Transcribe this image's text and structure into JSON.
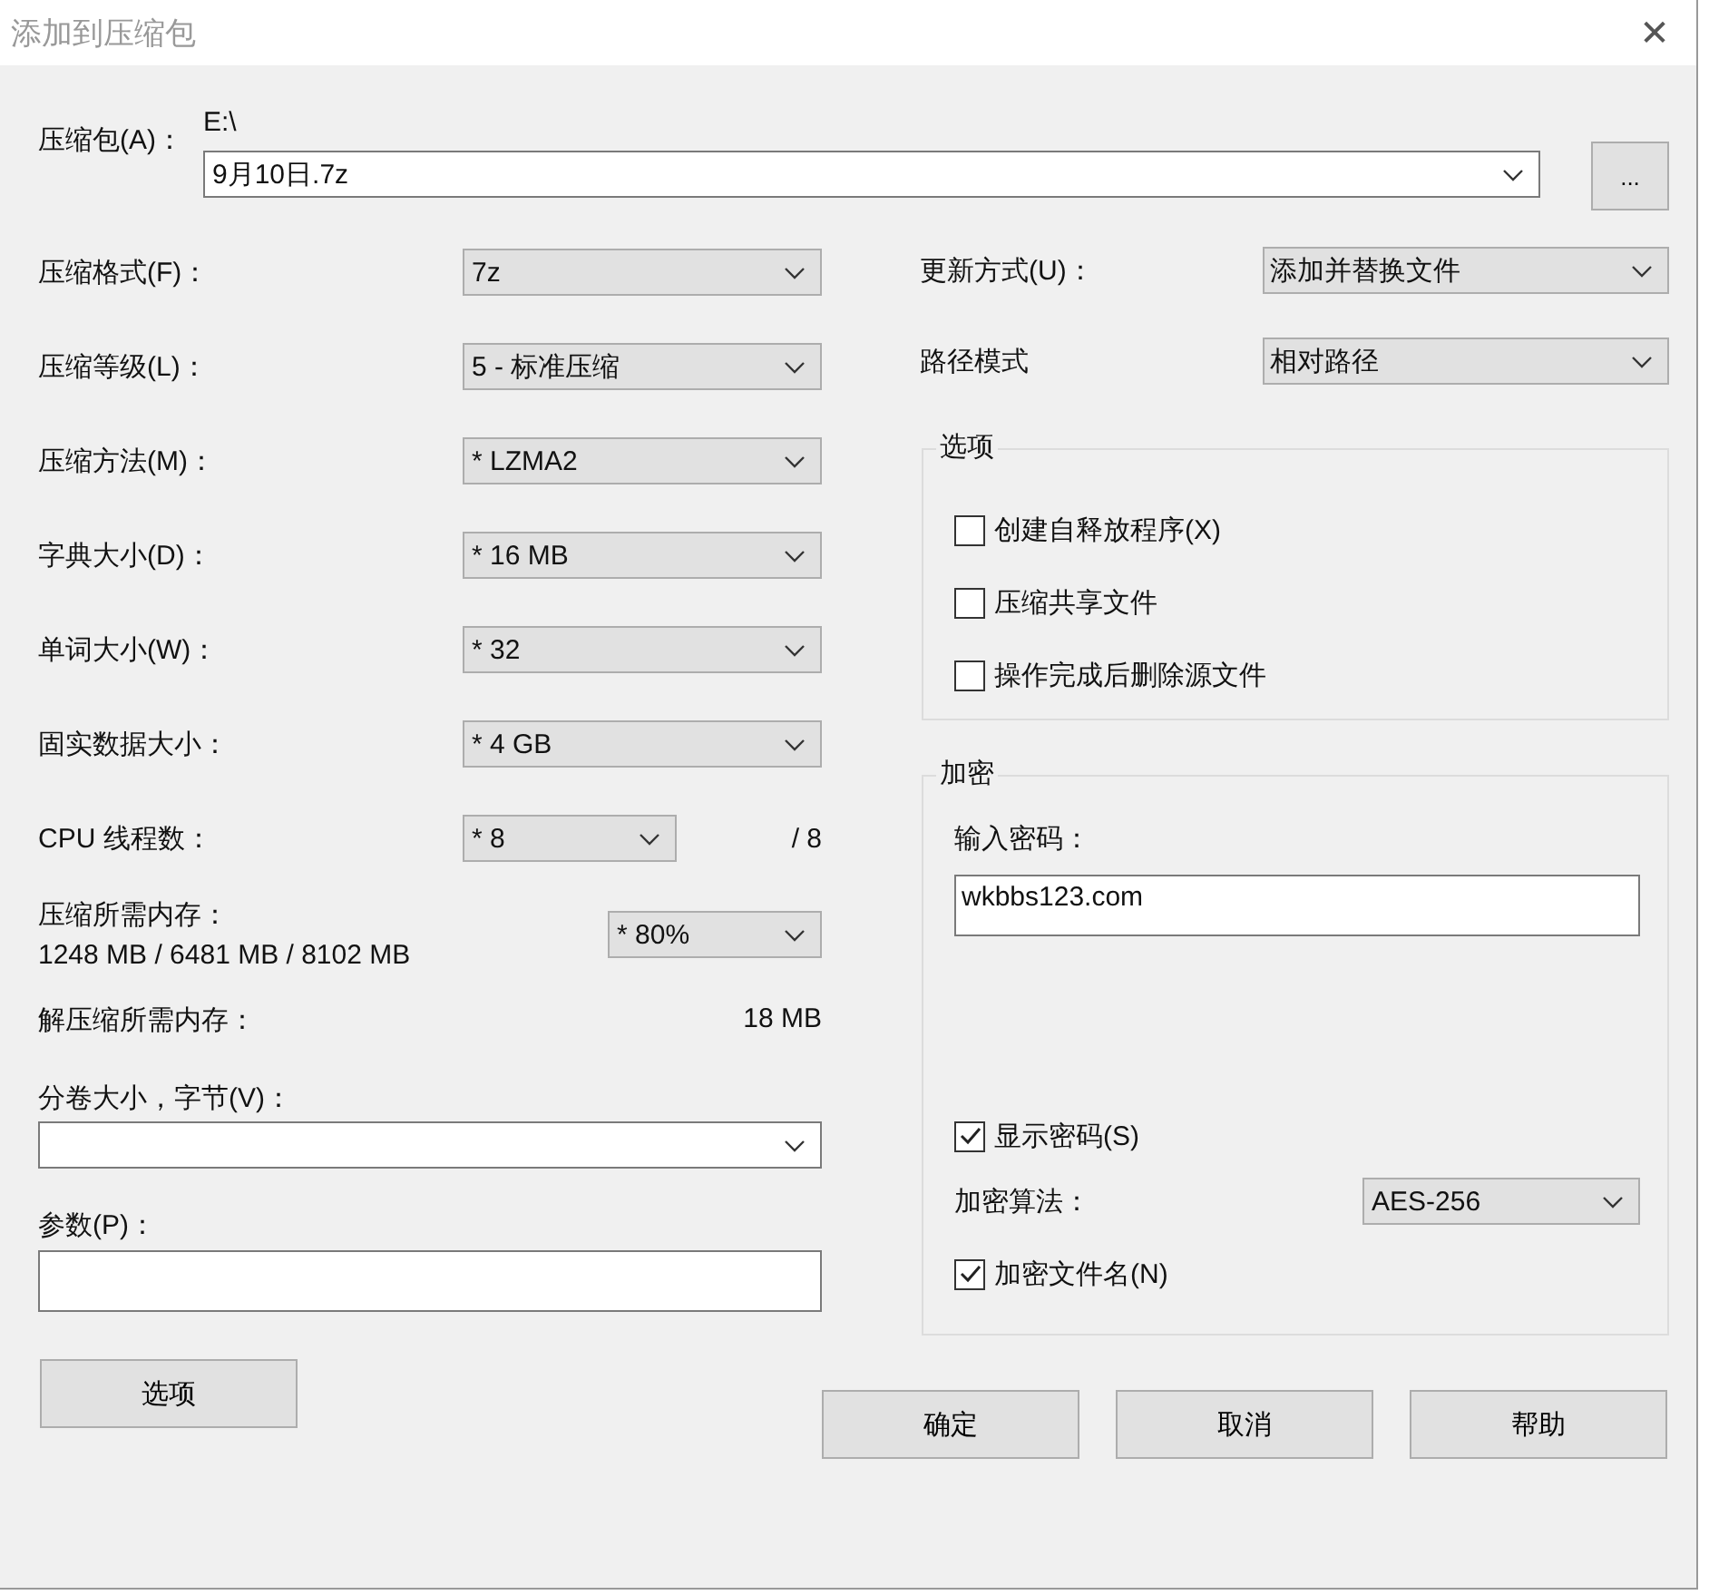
{
  "window": {
    "title": "添加到压缩包",
    "close": "✕"
  },
  "archive": {
    "label": "压缩包(A)：",
    "folder": "E:\\",
    "value": "9月10日.7z",
    "browse": "..."
  },
  "settings": [
    {
      "label": "压缩格式(F)：",
      "value": "7z"
    },
    {
      "label": "压缩等级(L)：",
      "value": "5 - 标准压缩"
    },
    {
      "label": "压缩方法(M)：",
      "value": "*  LZMA2"
    },
    {
      "label": "字典大小(D)：",
      "value": "*  16 MB"
    },
    {
      "label": "单词大小(W)：",
      "value": "*  32"
    },
    {
      "label": "固实数据大小：",
      "value": "*  4 GB"
    }
  ],
  "threads": {
    "label": "CPU 线程数：",
    "value": "*  8",
    "max": "/ 8"
  },
  "memory": {
    "label": "压缩所需内存：",
    "usage": "1248 MB / 6481 MB / 8102 MB",
    "value": "* 80%"
  },
  "decompress_memory": {
    "label": "解压缩所需内存：",
    "value": "18 MB"
  },
  "volume": {
    "label": "分卷大小，字节(V)："
  },
  "parameters": {
    "label": "参数(P)："
  },
  "options_button": "选项",
  "update": {
    "label": "更新方式(U)：",
    "value": "添加并替换文件"
  },
  "path_mode": {
    "label": "路径模式",
    "value": "相对路径"
  },
  "options": {
    "title": "选项",
    "items": [
      {
        "label": "创建自释放程序(X)",
        "checked": false
      },
      {
        "label": "压缩共享文件",
        "checked": false
      },
      {
        "label": "操作完成后删除源文件",
        "checked": false
      }
    ]
  },
  "encryption": {
    "title": "加密",
    "password_label": "输入密码：",
    "password": "wkbbs123.com",
    "show_password": {
      "label": "显示密码(S)",
      "checked": true
    },
    "method_label": "加密算法：",
    "method": "AES-256",
    "encrypt_names": {
      "label": "加密文件名(N)",
      "checked": true
    }
  },
  "buttons": [
    "确定",
    "取消",
    "帮助"
  ]
}
